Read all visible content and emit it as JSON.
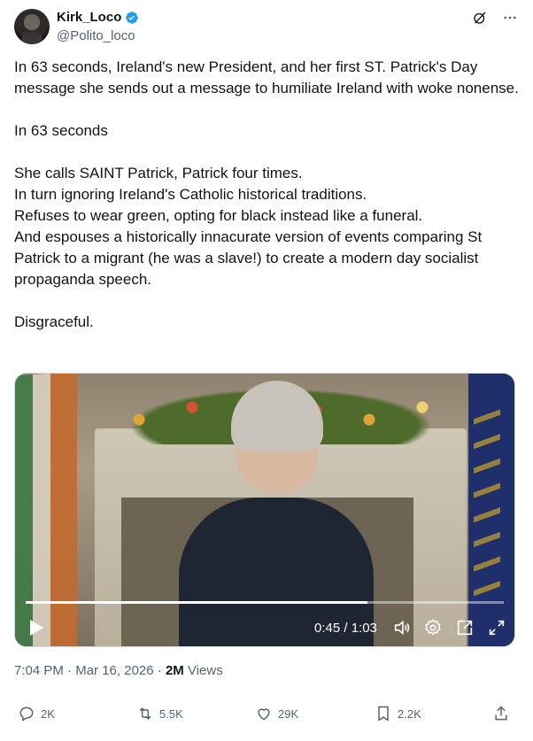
{
  "author": {
    "display_name": "Kirk_Loco",
    "handle": "@Polito_loco",
    "verified": true
  },
  "header_icons": [
    "grok-icon",
    "more-icon"
  ],
  "tweet": {
    "paragraphs": [
      "In 63 seconds, Ireland's new President, and her first ST. Patrick's Day message she sends out a message to humiliate Ireland with woke nonense.",
      "In 63 seconds",
      "She calls SAINT Patrick, Patrick four times.\nIn turn ignoring Ireland's Catholic historical traditions.\nRefuses to wear green, opting for black instead like a funeral.\nAnd espouses a historically innacurate version of events comparing St Patrick to a migrant (he was a slave!) to create a modern day socialist propaganda speech.",
      "Disgraceful."
    ]
  },
  "video": {
    "current_time": "0:45",
    "duration": "1:03",
    "time_display": "0:45 / 1:03",
    "progress": 0.714
  },
  "meta": {
    "time": "7:04 PM",
    "date": "Mar 16, 2026",
    "views_count": "2M",
    "views_label": "Views"
  },
  "actions": {
    "replies": "2K",
    "reposts": "5.5K",
    "likes": "29K",
    "bookmarks": "2.2K"
  },
  "colors": {
    "text": "#0f1419",
    "secondary": "#536471",
    "verified": "#1d9bf0",
    "border": "#cfd9de"
  }
}
